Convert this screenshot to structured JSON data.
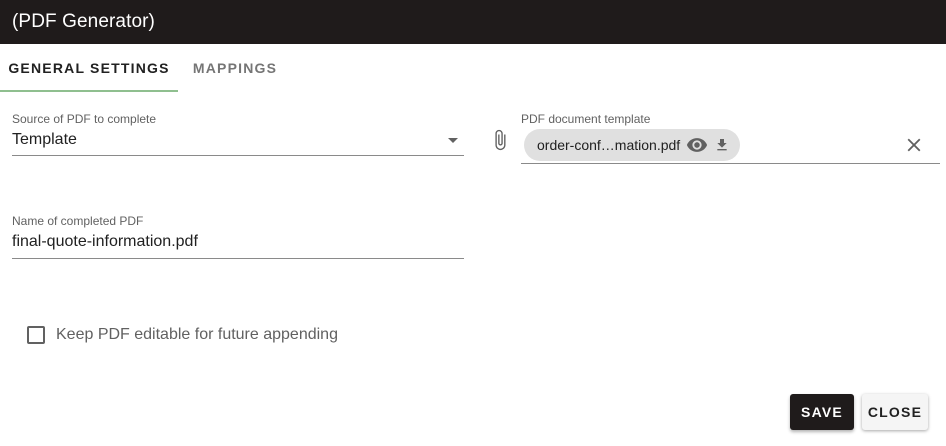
{
  "window": {
    "title": "(PDF Generator)"
  },
  "tabs": [
    {
      "label": "GENERAL SETTINGS",
      "active": true
    },
    {
      "label": "MAPPINGS",
      "active": false
    }
  ],
  "source": {
    "label": "Source of PDF to complete",
    "value": "Template"
  },
  "template": {
    "label": "PDF document template",
    "file_name": "order-conf…mation.pdf"
  },
  "completed_name": {
    "label": "Name of completed PDF",
    "value": "final-quote-information.pdf"
  },
  "keep_editable": {
    "label": "Keep PDF editable for future appending",
    "checked": false
  },
  "buttons": {
    "save": "SAVE",
    "close": "CLOSE"
  },
  "icons": {
    "attach": "paperclip-icon",
    "preview": "eye-icon",
    "download": "download-icon",
    "clear": "close-icon",
    "dropdown": "dropdown-arrow-icon"
  },
  "colors": {
    "titlebar": "#1f1b1b",
    "tab_indicator": "#8fbf8f",
    "chip": "#e0e0e0"
  }
}
